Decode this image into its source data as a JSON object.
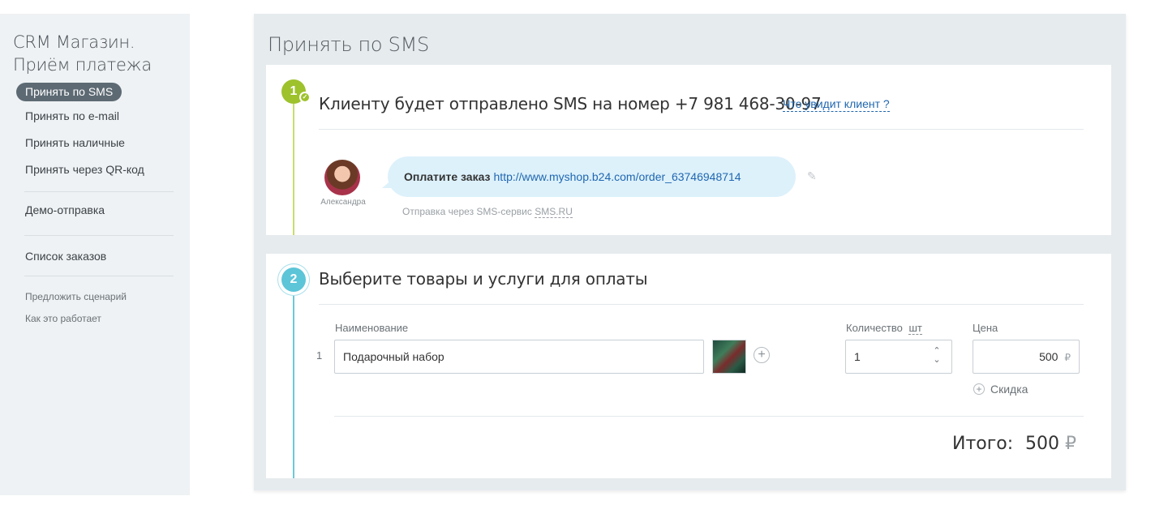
{
  "sidebar": {
    "title_line1": "CRM Магазин.",
    "title_line2": "Приём платежа",
    "active_item": "Принять по SMS",
    "items": [
      {
        "label": "Принять по e-mail"
      },
      {
        "label": "Принять наличные"
      },
      {
        "label": "Принять через QR-код"
      },
      {
        "label": "Демо-отправка"
      },
      {
        "label": "Список заказов"
      },
      {
        "label": "Предложить сценарий"
      },
      {
        "label": "Как это работает"
      }
    ]
  },
  "panel": {
    "title": "Принять по SMS"
  },
  "step1": {
    "number": "1",
    "heading": "Клиенту будет отправлено SMS на номер +7 981 468-30-97",
    "preview_link": "Что увидит клиент ?",
    "avatar_name": "Александра",
    "message_text": "Оплатите заказ",
    "message_link": "http://www.myshop.b24.com/order_63746948714",
    "sms_note_prefix": "Отправка через SMS-сервис",
    "sms_service": "SMS.RU",
    "icons": {
      "check": "check-icon",
      "edit": "pencil-icon"
    }
  },
  "step2": {
    "number": "2",
    "heading": "Выберите товары и услуги для оплаты",
    "col_name": "Наименование",
    "col_qty": "Количество",
    "col_qty_unit": "шт",
    "col_price": "Цена",
    "rows": [
      {
        "num": "1",
        "name": "Подарочный набор",
        "qty": "1",
        "price": "500",
        "currency": "₽"
      }
    ],
    "discount_label": "Скидка",
    "total_label": "Итого:",
    "total_value": "500",
    "total_currency": "₽"
  },
  "colors": {
    "step1_accent": "#9dc22c",
    "step2_accent": "#5cc5d8",
    "link": "#2067b0",
    "bubble": "#ddf1fb",
    "sidebar_bg": "#eef2f4",
    "panel_bg": "#e6ebee"
  }
}
